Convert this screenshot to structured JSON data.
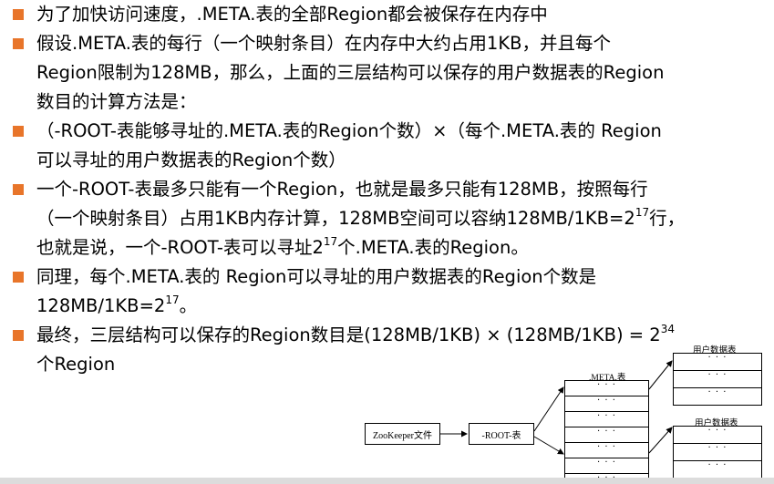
{
  "bullets": [
    {
      "lines": [
        "为了加快访问速度，.META.表的全部Region都会被保存在内存中"
      ]
    },
    {
      "lines": [
        "假设.META.表的每行（一个映射条目）在内存中大约占用1KB，并且每个",
        "Region限制为128MB，那么，上面的三层结构可以保存的用户数据表的Region",
        "数目的计算方法是："
      ]
    },
    {
      "lines": [
        "（-ROOT-表能够寻址的.META.表的Region个数）×（每个.META.表的 Region",
        "可以寻址的用户数据表的Region个数）"
      ]
    },
    {
      "line1": "一个-ROOT-表最多只能有一个Region，也就是最多只能有128MB，按照每行",
      "line2a": "（一个映射条目）占用1KB内存计算，128MB空间可以容纳128MB/1KB=2",
      "line2sup": "17",
      "line2b": "行，",
      "line3a": "也就是说，一个-ROOT-表可以寻址2",
      "line3sup": "17",
      "line3b": "个.META.表的Region。"
    },
    {
      "line1": "同理，每个.META.表的 Region可以寻址的用户数据表的Region个数是",
      "line2a": "128MB/1KB=2",
      "line2sup": "17",
      "line2b": "。"
    },
    {
      "line1a": "最终，三层结构可以保存的Region数目是(128MB/1KB) × (128MB/1KB) = 2",
      "line1sup": "34",
      "line2": "个Region"
    }
  ],
  "diagram": {
    "zookeeper_label": "ZooKeeper文件",
    "root_label": "-ROOT-表",
    "meta_label": ".META.表",
    "user_table_label_1": "用户数据表",
    "user_table_label_2": "用户数据表",
    "dots": "· · ·"
  },
  "colors": {
    "bullet": "#e8752a",
    "bottom_bar": "#dcdcdc"
  }
}
